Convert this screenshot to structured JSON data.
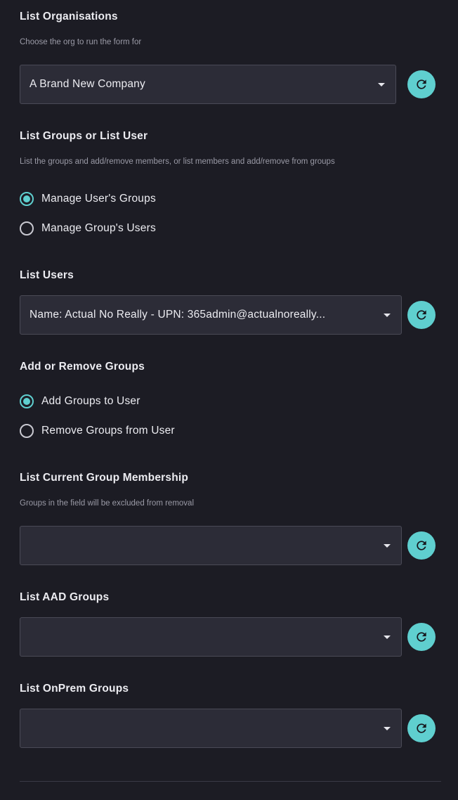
{
  "colors": {
    "background": "#1c1c24",
    "accent": "#5fcfcf",
    "field": "#2c2c37"
  },
  "org": {
    "label": "List Organisations",
    "description": "Choose the org to run the form for",
    "selected": "A Brand New Company",
    "refresh_icon": "refresh-icon"
  },
  "mode": {
    "label": "List Groups or List User",
    "description": "List the groups and add/remove members, or list members and add/remove from groups",
    "options": [
      {
        "label": "Manage User's Groups",
        "checked": true
      },
      {
        "label": "Manage Group's Users",
        "checked": false
      }
    ]
  },
  "users": {
    "label": "List Users",
    "selected": "Name: Actual No Really - UPN: 365admin@actualnoreally...",
    "refresh_icon": "refresh-icon"
  },
  "action": {
    "label": "Add or Remove Groups",
    "options": [
      {
        "label": "Add Groups to User",
        "checked": true
      },
      {
        "label": "Remove Groups from User",
        "checked": false
      }
    ]
  },
  "current_membership": {
    "label": "List Current Group Membership",
    "description": "Groups in the field will be excluded from removal",
    "selected": ""
  },
  "aad_groups": {
    "label": "List AAD Groups",
    "selected": ""
  },
  "onprem_groups": {
    "label": "List OnPrem Groups",
    "selected": ""
  }
}
